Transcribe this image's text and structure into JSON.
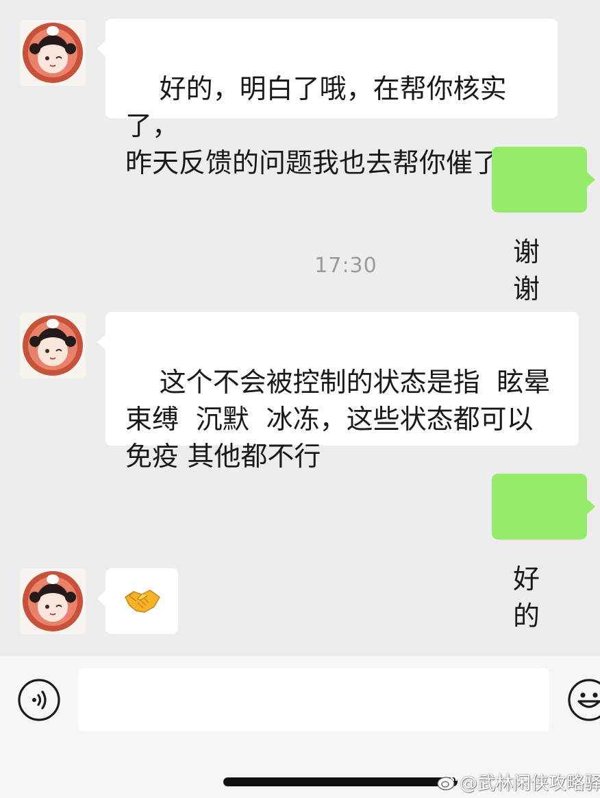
{
  "chat": {
    "messages": [
      {
        "side": "left",
        "text": "好的，明白了哦，在帮你核实了，\n昨天反馈的问题我也去帮你催了"
      },
      {
        "side": "right",
        "text": "谢谢"
      },
      {
        "side": "left",
        "text": "这个不会被控制的状态是指  眩晕\n束缚  沉默  冰冻，这些状态都可以\n免疫 其他都不行"
      },
      {
        "side": "right",
        "text": "好的"
      },
      {
        "side": "left",
        "emoji": "handshake-emoji"
      }
    ],
    "timestamp": "17:30"
  },
  "input_bar": {
    "input_value": "",
    "voice_icon": "voice-icon",
    "emoji_icon": "smiley-icon"
  },
  "watermark": {
    "text": "@武林闲侠攻略驿馆",
    "icon": "weibo-icon"
  },
  "colors": {
    "chat_background": "#ededed",
    "own_bubble": "#95ec69",
    "other_bubble": "#ffffff",
    "timestamp_text": "#9a9a9a"
  }
}
